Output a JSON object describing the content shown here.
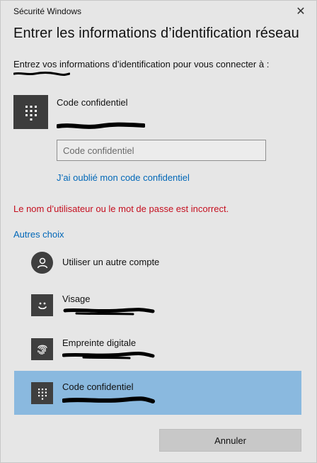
{
  "window": {
    "title": "Sécurité Windows",
    "close_symbol": "✕"
  },
  "header": {
    "title": "Entrer les informations d’identification réseau",
    "intro": "Entrez vos informations d’identification pour vous connecter à :"
  },
  "credential": {
    "icon": "keypad-icon",
    "label": "Code confidentiel"
  },
  "pin_field": {
    "placeholder": "Code confidentiel",
    "value": ""
  },
  "links": {
    "forgot_pin": "J’ai oublié mon code confidentiel"
  },
  "status": {
    "error": "Le nom d’utilisateur ou le mot de passe est incorrect."
  },
  "choices": {
    "heading": "Autres choix",
    "options": [
      {
        "label": "Utiliser un autre compte",
        "icon": "user-icon",
        "selected": false
      },
      {
        "label": "Visage",
        "icon": "face-icon",
        "selected": false
      },
      {
        "label": "Empreinte digitale",
        "icon": "fingerprint-icon",
        "selected": false
      },
      {
        "label": "Code confidentiel",
        "icon": "keypad-icon",
        "selected": true
      }
    ]
  },
  "buttons": {
    "cancel": "Annuler"
  },
  "colors": {
    "background": "#e6e6e6",
    "accent_link": "#0067b8",
    "error": "#c50f1f",
    "selected_option": "#8ab9df",
    "tile": "#3c3c3c"
  }
}
